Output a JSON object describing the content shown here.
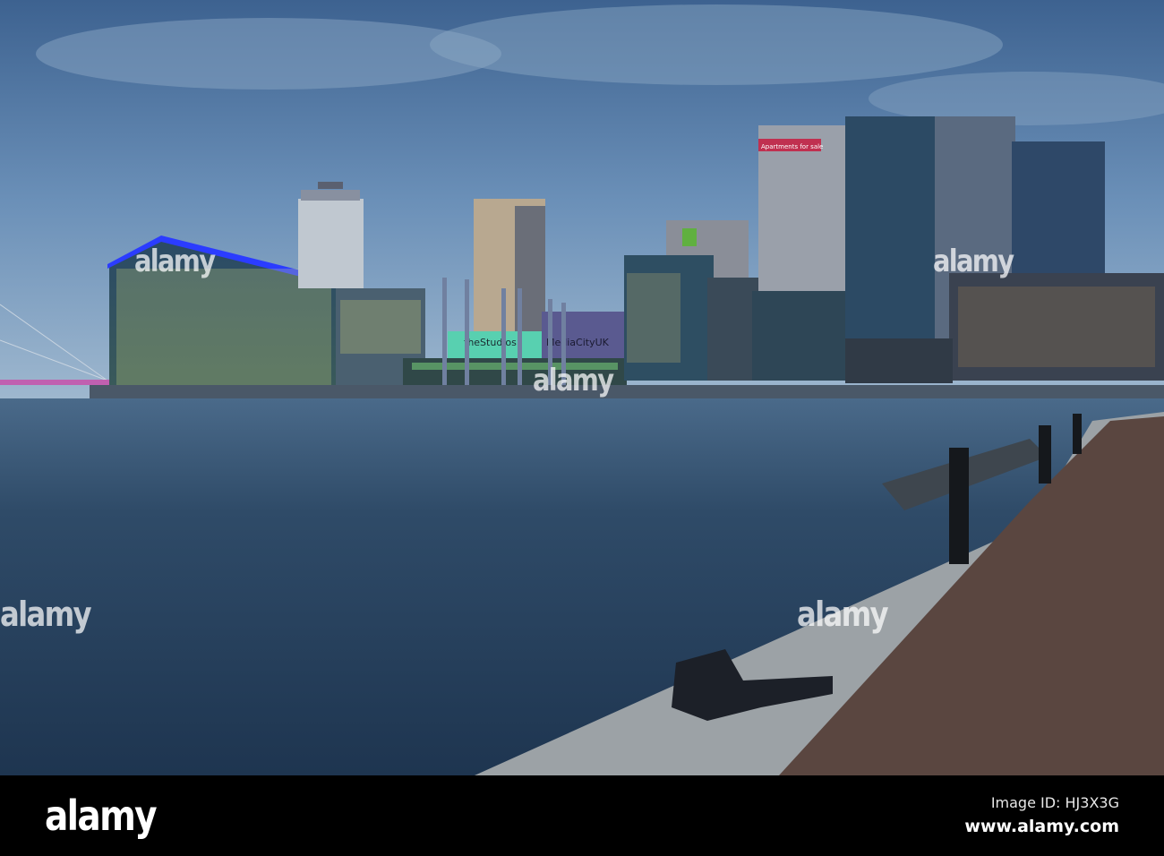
{
  "photo": {
    "subject": "MediaCityUK waterfront at dusk",
    "signs": {
      "studios": "theStudios",
      "mediacity": "MediaCityUK",
      "apartments": "Apartments for sale"
    }
  },
  "watermark": {
    "text": "alamy"
  },
  "footer": {
    "logo": "alamy",
    "image_id": "Image ID: HJ3X3G",
    "url": "www.alamy.com"
  },
  "colors": {
    "sky": "#5a7fa8",
    "water": "#2e4a66",
    "accent_blue": "#2a3cff"
  }
}
